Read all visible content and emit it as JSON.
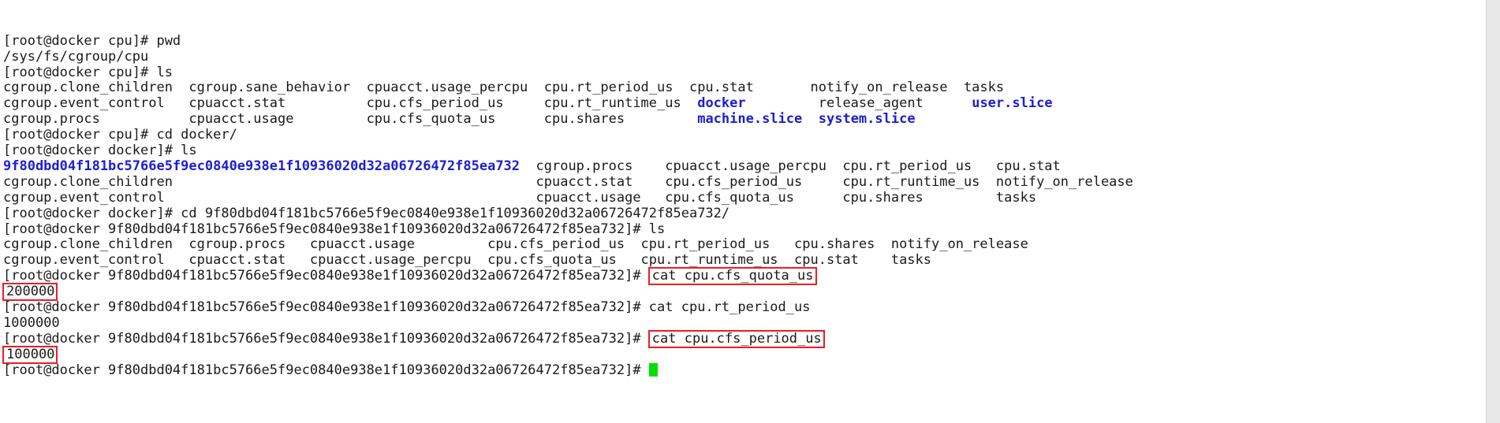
{
  "terminal": {
    "cursor_glyph": "block-cursor",
    "colors": {
      "background": "#ffffff",
      "foreground": "#1a1a1a",
      "directory": "#1d1dd4",
      "highlight_box": "#ee1c25",
      "cursor": "#00e000"
    },
    "lines": [
      {
        "id": "l1",
        "segments": [
          {
            "text": "[root@docker cpu]# pwd",
            "type": "plain"
          }
        ]
      },
      {
        "id": "l2",
        "segments": [
          {
            "text": "/sys/fs/cgroup/cpu",
            "type": "plain"
          }
        ]
      },
      {
        "id": "l3",
        "segments": [
          {
            "text": "[root@docker cpu]# ls",
            "type": "plain"
          }
        ]
      },
      {
        "id": "l4",
        "segments": [
          {
            "text": "cgroup.clone_children  cgroup.sane_behavior  cpuacct.usage_percpu  cpu.rt_period_us  cpu.stat       notify_on_release  tasks",
            "type": "plain"
          }
        ]
      },
      {
        "id": "l5",
        "segments": [
          {
            "text": "cgroup.event_control   cpuacct.stat          cpu.cfs_period_us     cpu.rt_runtime_us  ",
            "type": "plain"
          },
          {
            "text": "docker",
            "type": "dir"
          },
          {
            "text": "         release_agent      ",
            "type": "plain"
          },
          {
            "text": "user.slice",
            "type": "dir"
          }
        ]
      },
      {
        "id": "l6",
        "segments": [
          {
            "text": "cgroup.procs           cpuacct.usage         cpu.cfs_quota_us      cpu.shares         ",
            "type": "plain"
          },
          {
            "text": "machine.slice",
            "type": "dir"
          },
          {
            "text": "  ",
            "type": "plain"
          },
          {
            "text": "system.slice",
            "type": "dir"
          }
        ]
      },
      {
        "id": "l7",
        "segments": [
          {
            "text": "[root@docker cpu]# cd docker/",
            "type": "plain"
          }
        ]
      },
      {
        "id": "l8",
        "segments": [
          {
            "text": "[root@docker docker]# ls",
            "type": "plain"
          }
        ]
      },
      {
        "id": "l9",
        "segments": [
          {
            "text": "9f80dbd04f181bc5766e5f9ec0840e938e1f10936020d32a06726472f85ea732",
            "type": "dir"
          },
          {
            "text": "  cgroup.procs    cpuacct.usage_percpu  cpu.rt_period_us   cpu.stat",
            "type": "plain"
          }
        ]
      },
      {
        "id": "l10",
        "segments": [
          {
            "text": "cgroup.clone_children                                             cpuacct.stat    cpu.cfs_period_us     cpu.rt_runtime_us  notify_on_release",
            "type": "plain"
          }
        ]
      },
      {
        "id": "l11",
        "segments": [
          {
            "text": "cgroup.event_control                                              cpuacct.usage   cpu.cfs_quota_us      cpu.shares         tasks",
            "type": "plain"
          }
        ]
      },
      {
        "id": "l12",
        "segments": [
          {
            "text": "[root@docker docker]# cd 9f80dbd04f181bc5766e5f9ec0840e938e1f10936020d32a06726472f85ea732/",
            "type": "plain"
          }
        ]
      },
      {
        "id": "l13",
        "segments": [
          {
            "text": "[root@docker 9f80dbd04f181bc5766e5f9ec0840e938e1f10936020d32a06726472f85ea732]# ls",
            "type": "plain"
          }
        ]
      },
      {
        "id": "l14",
        "segments": [
          {
            "text": "cgroup.clone_children  cgroup.procs   cpuacct.usage         cpu.cfs_period_us  cpu.rt_period_us   cpu.shares  notify_on_release",
            "type": "plain"
          }
        ]
      },
      {
        "id": "l15",
        "segments": [
          {
            "text": "cgroup.event_control   cpuacct.stat   cpuacct.usage_percpu  cpu.cfs_quota_us   cpu.rt_runtime_us  cpu.stat    tasks",
            "type": "plain"
          }
        ]
      },
      {
        "id": "l16",
        "segments": [
          {
            "text": "[root@docker 9f80dbd04f181bc5766e5f9ec0840e938e1f10936020d32a06726472f85ea732]# ",
            "type": "plain"
          },
          {
            "text": "cat cpu.cfs_quota_us",
            "type": "boxed"
          }
        ]
      },
      {
        "id": "l17",
        "segments": [
          {
            "text": "200000",
            "type": "boxed"
          }
        ]
      },
      {
        "id": "l18",
        "segments": [
          {
            "text": "[root@docker 9f80dbd04f181bc5766e5f9ec0840e938e1f10936020d32a06726472f85ea732]# cat cpu.rt_period_us",
            "type": "plain"
          }
        ]
      },
      {
        "id": "l19",
        "segments": [
          {
            "text": "1000000",
            "type": "plain"
          }
        ]
      },
      {
        "id": "l20",
        "segments": [
          {
            "text": "[root@docker 9f80dbd04f181bc5766e5f9ec0840e938e1f10936020d32a06726472f85ea732]# ",
            "type": "plain"
          },
          {
            "text": "cat cpu.cfs_period_us",
            "type": "boxed"
          }
        ]
      },
      {
        "id": "l21",
        "segments": [
          {
            "text": "100000",
            "type": "boxed"
          }
        ]
      },
      {
        "id": "l22",
        "segments": [
          {
            "text": "[root@docker 9f80dbd04f181bc5766e5f9ec0840e938e1f10936020d32a06726472f85ea732]# ",
            "type": "plain"
          },
          {
            "text": "",
            "type": "cursor"
          }
        ]
      }
    ]
  }
}
